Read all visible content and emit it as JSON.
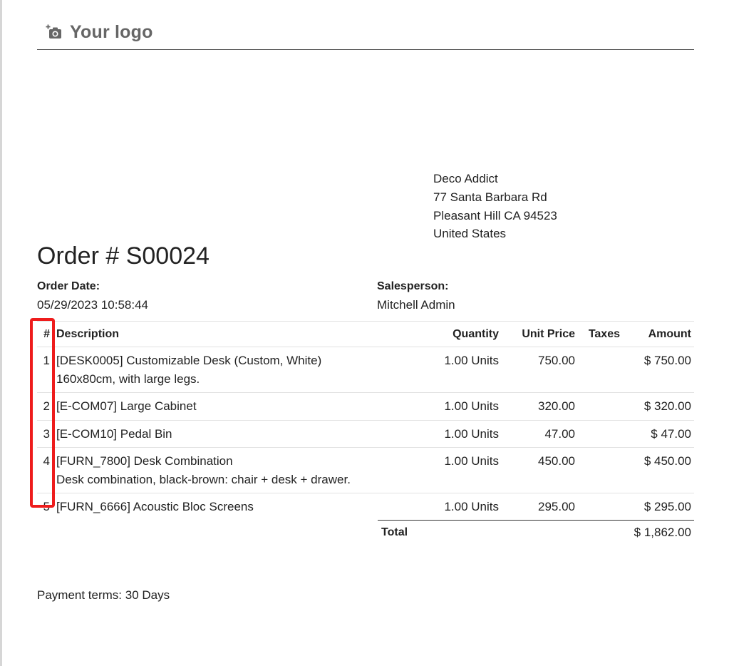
{
  "logo": {
    "text": "Your logo",
    "icon": "camera-plus-icon"
  },
  "customer": {
    "name": "Deco Addict",
    "street": "77 Santa Barbara Rd",
    "city_line": "Pleasant Hill CA 94523",
    "country": "United States"
  },
  "order": {
    "title": "Order # S00024",
    "date_label": "Order Date:",
    "date": "05/29/2023 10:58:44",
    "salesperson_label": "Salesperson:",
    "salesperson": "Mitchell Admin"
  },
  "table": {
    "headers": {
      "num": "#",
      "description": "Description",
      "quantity": "Quantity",
      "unit_price": "Unit Price",
      "taxes": "Taxes",
      "amount": "Amount"
    },
    "rows": [
      {
        "num": "1",
        "description": "[DESK0005] Customizable Desk (Custom, White)",
        "description_extra": "160x80cm, with large legs.",
        "quantity": "1.00 Units",
        "unit_price": "750.00",
        "taxes": "",
        "amount": "$ 750.00"
      },
      {
        "num": "2",
        "description": "[E-COM07] Large Cabinet",
        "description_extra": "",
        "quantity": "1.00 Units",
        "unit_price": "320.00",
        "taxes": "",
        "amount": "$ 320.00"
      },
      {
        "num": "3",
        "description": "[E-COM10] Pedal Bin",
        "description_extra": "",
        "quantity": "1.00 Units",
        "unit_price": "47.00",
        "taxes": "",
        "amount": "$ 47.00"
      },
      {
        "num": "4",
        "description": "[FURN_7800] Desk Combination",
        "description_extra": "Desk combination, black-brown: chair + desk + drawer.",
        "quantity": "1.00 Units",
        "unit_price": "450.00",
        "taxes": "",
        "amount": "$ 450.00"
      },
      {
        "num": "5",
        "description": "[FURN_6666] Acoustic Bloc Screens",
        "description_extra": "",
        "quantity": "1.00 Units",
        "unit_price": "295.00",
        "taxes": "",
        "amount": "$ 295.00"
      }
    ]
  },
  "totals": {
    "label": "Total",
    "value": "$ 1,862.00"
  },
  "payment_terms": "Payment terms: 30 Days",
  "colors": {
    "highlight": "#ee1c1c",
    "logo_text": "#666666"
  }
}
